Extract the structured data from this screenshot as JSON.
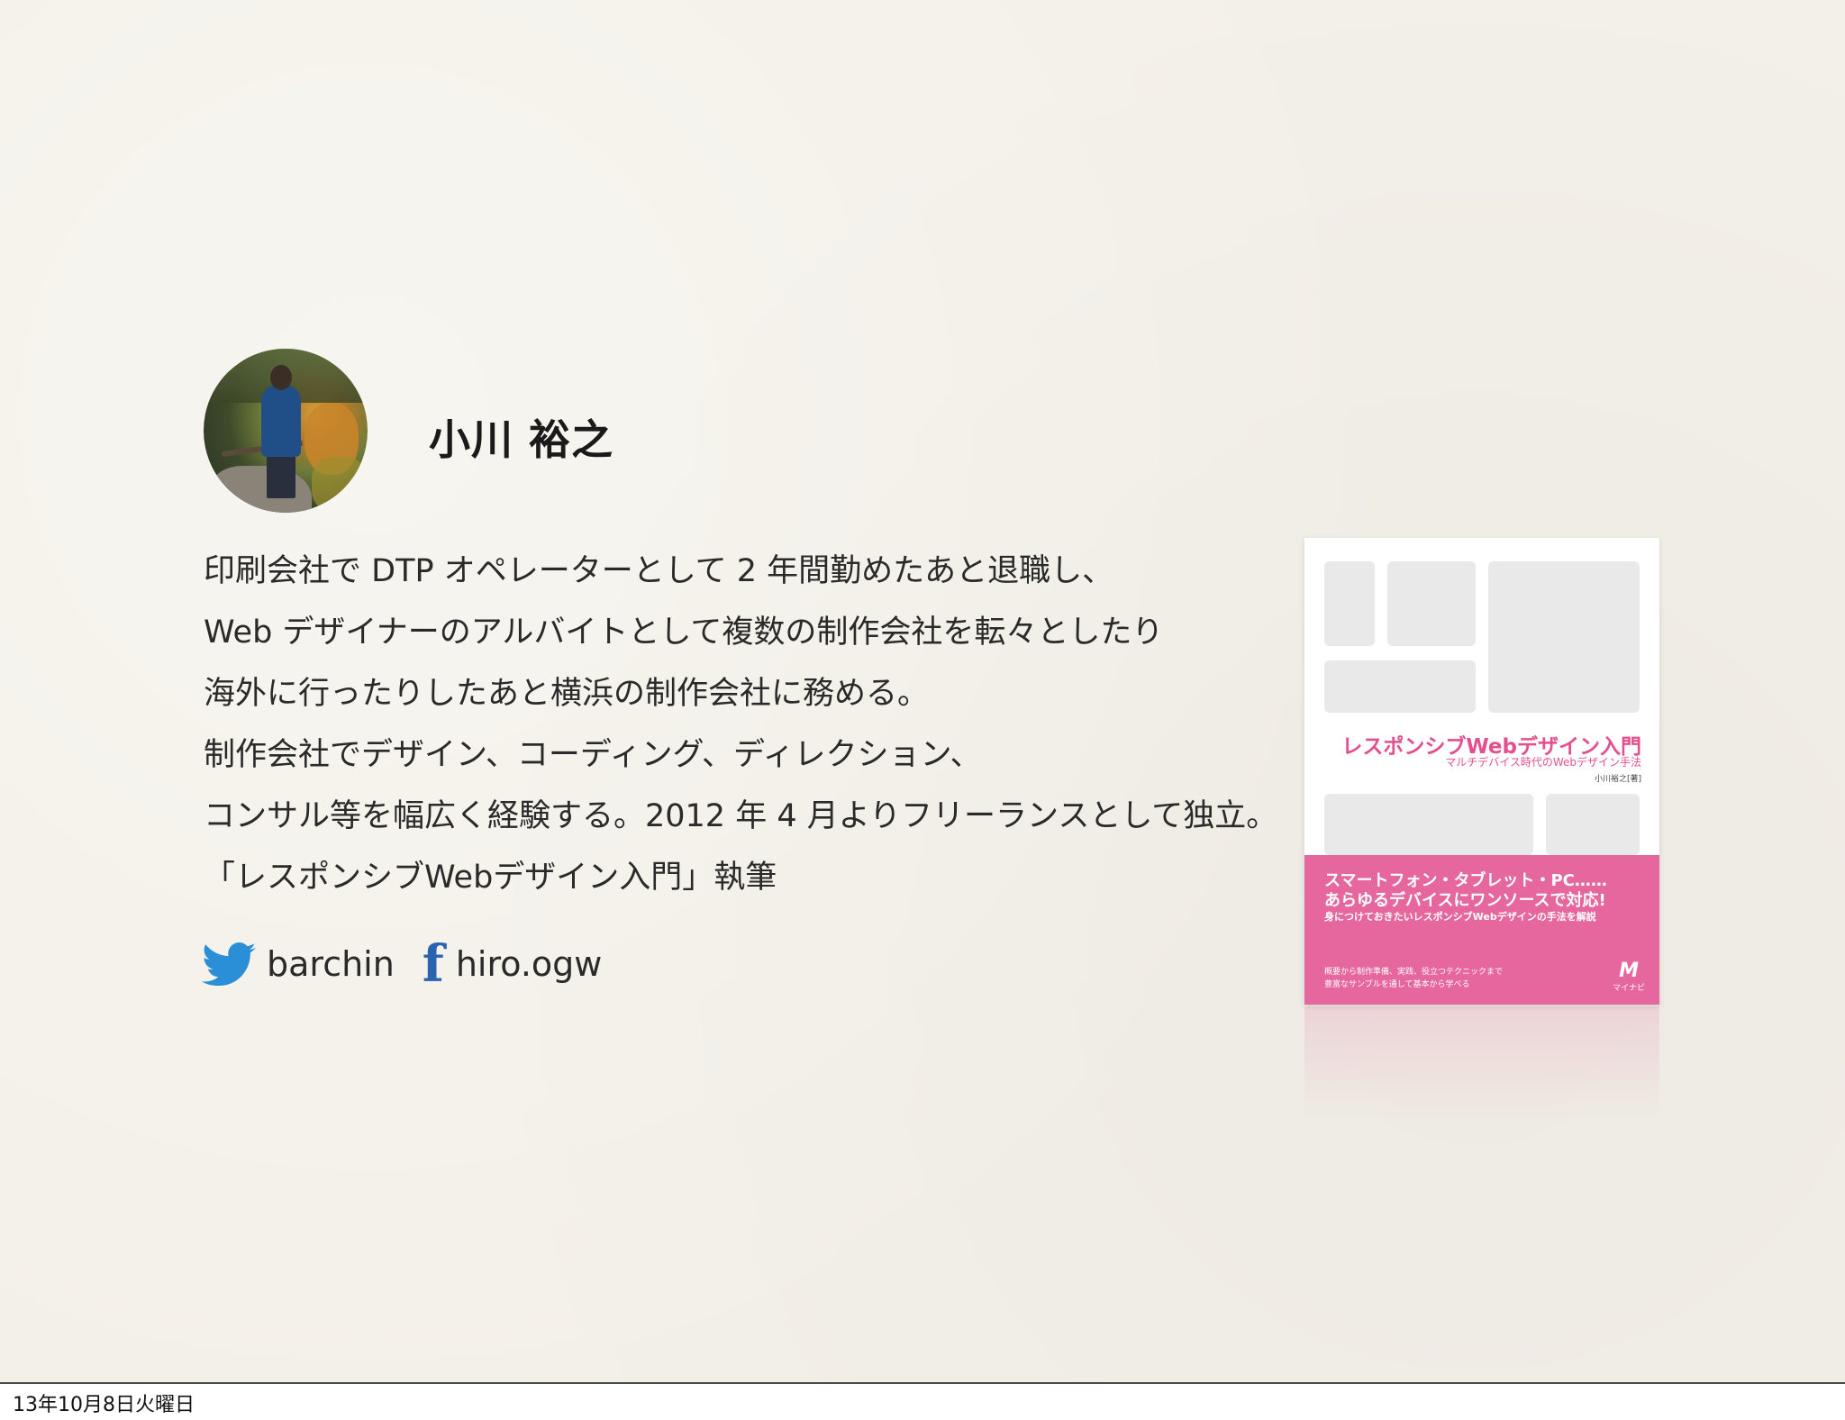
{
  "slide": {
    "name": "小川 裕之",
    "bio_lines": [
      "印刷会社で DTP オペレーターとして 2 年間勤めたあと退職し、",
      "Web デザイナーのアルバイトとして複数の制作会社を転々としたり",
      "海外に行ったりしたあと横浜の制作会社に務める。",
      "制作会社でデザイン、コーディング、ディレクション、",
      "コンサル等を幅広く経験する。2012 年 4 月よりフリーランスとして独立。",
      "「レスポンシブWebデザイン入門」執筆"
    ],
    "socials": {
      "twitter": {
        "icon": "twitter-bird-icon",
        "handle": "barchin",
        "color": "#2a8fd6"
      },
      "facebook": {
        "icon": "facebook-f-icon",
        "handle": "hiro.ogw",
        "color": "#2a63b0"
      }
    },
    "book": {
      "title": "レスポンシブWebデザイン入門",
      "subtitle": "マルチデバイス時代のWebデザイン手法",
      "author": "小川裕之[著]",
      "band_line1": "スマートフォン・タブレット・PC……",
      "band_line2": "あらゆるデバイスにワンソースで対応!",
      "band_line3": "身につけておきたいレスポンシブWebデザインの手法を解説",
      "band_line4": "概要から制作準備、実践、役立つテクニックまで",
      "band_line5": "豊富なサンプルを通して基本から学べる",
      "publisher_mark": "M",
      "publisher": "マイナビ",
      "accent_color": "#e4508f"
    }
  },
  "footer": {
    "date": "13年10月8日火曜日"
  }
}
